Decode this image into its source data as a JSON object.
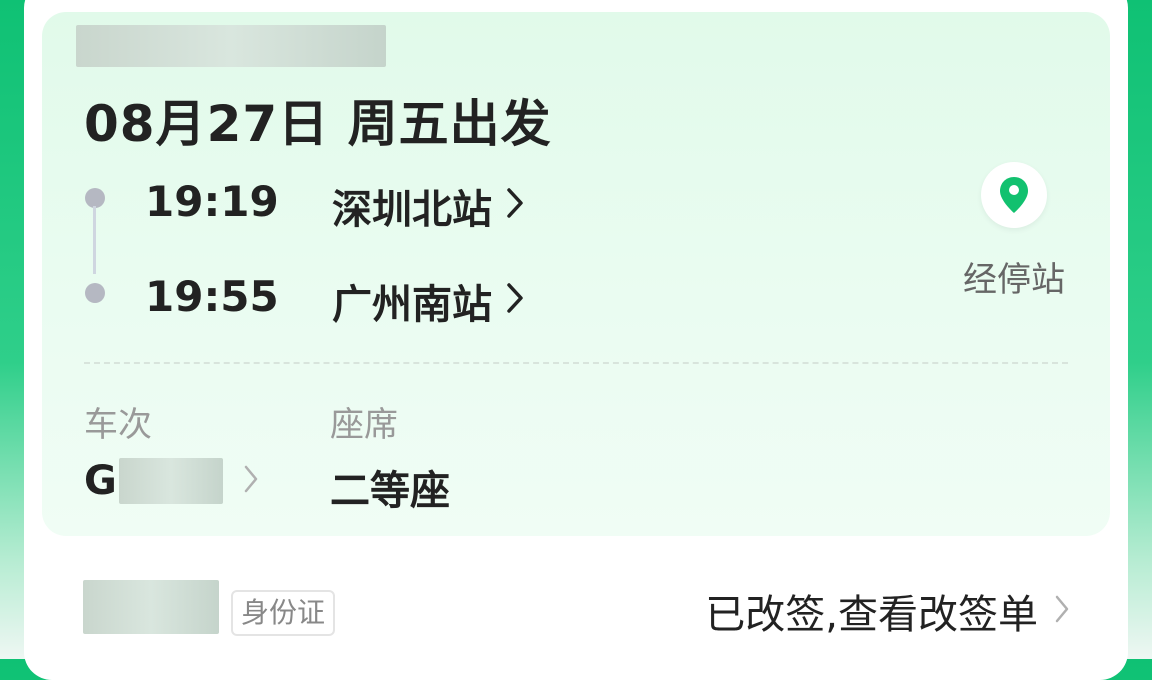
{
  "trip": {
    "date_heading": "08月27日 周五出发",
    "departure": {
      "time": "19:19",
      "station": "深圳北站"
    },
    "arrival": {
      "time": "19:55",
      "station": "广州南站"
    },
    "stops_label": "经停站"
  },
  "details": {
    "train_label": "车次",
    "train_prefix": "G",
    "seat_label": "座席",
    "seat_value": "二等座"
  },
  "passenger": {
    "id_type": "身份证",
    "reissue_text": "已改签,查看改签单"
  },
  "colors": {
    "accent": "#0fc174",
    "pin": "#12c16f"
  },
  "icons": {
    "location": "location-pin-icon",
    "chevron": "chevron-right-icon"
  }
}
